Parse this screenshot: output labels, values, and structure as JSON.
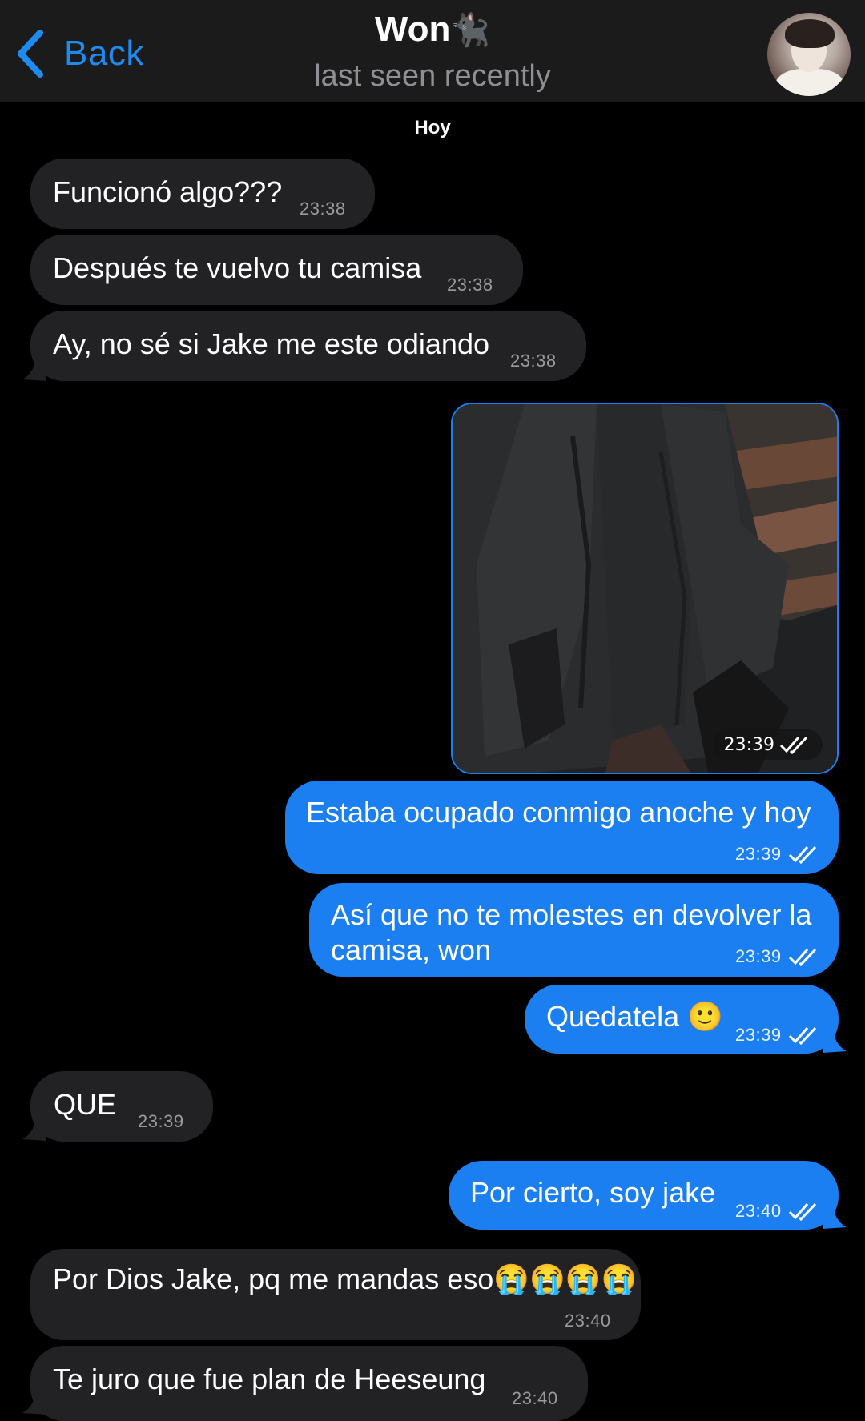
{
  "header": {
    "back_label": "Back",
    "title": "Won",
    "title_emoji": "🐈‍⬛",
    "status": "last seen recently"
  },
  "day_label": "Hoy",
  "messages": [
    {
      "dir": "in",
      "text": "Funcionó algo???",
      "time": "23:38"
    },
    {
      "dir": "in",
      "text": "Después te vuelvo tu camisa",
      "time": "23:38"
    },
    {
      "dir": "in",
      "text": "Ay, no sé si Jake me este odiando",
      "time": "23:38"
    },
    {
      "dir": "out",
      "type": "photo",
      "time": "23:39",
      "read": true
    },
    {
      "dir": "out",
      "text": "Estaba ocupado conmigo anoche y hoy",
      "time": "23:39",
      "read": true
    },
    {
      "dir": "out",
      "text_line1": "Así que no te molestes en devolver la",
      "text_line2": "camisa, won",
      "time": "23:39",
      "read": true
    },
    {
      "dir": "out",
      "text": "Quedatela 🙂",
      "time": "23:39",
      "read": true
    },
    {
      "dir": "in",
      "text": "QUE",
      "time": "23:39"
    },
    {
      "dir": "out",
      "text": "Por cierto, soy jake",
      "time": "23:40",
      "read": true
    },
    {
      "dir": "in",
      "text": "Por Dios Jake, pq me mandas eso😭😭😭😭",
      "time": "23:40"
    },
    {
      "dir": "in",
      "text": "Te juro que fue plan de Heeseung",
      "time": "23:40"
    }
  ],
  "colors": {
    "background": "#000000",
    "incoming_bubble": "#222224",
    "outgoing_bubble": "#1b7ff2",
    "accent": "#1e8bf0"
  },
  "icons": {
    "back": "chevron-left-icon",
    "read_receipt": "double-check-icon"
  }
}
